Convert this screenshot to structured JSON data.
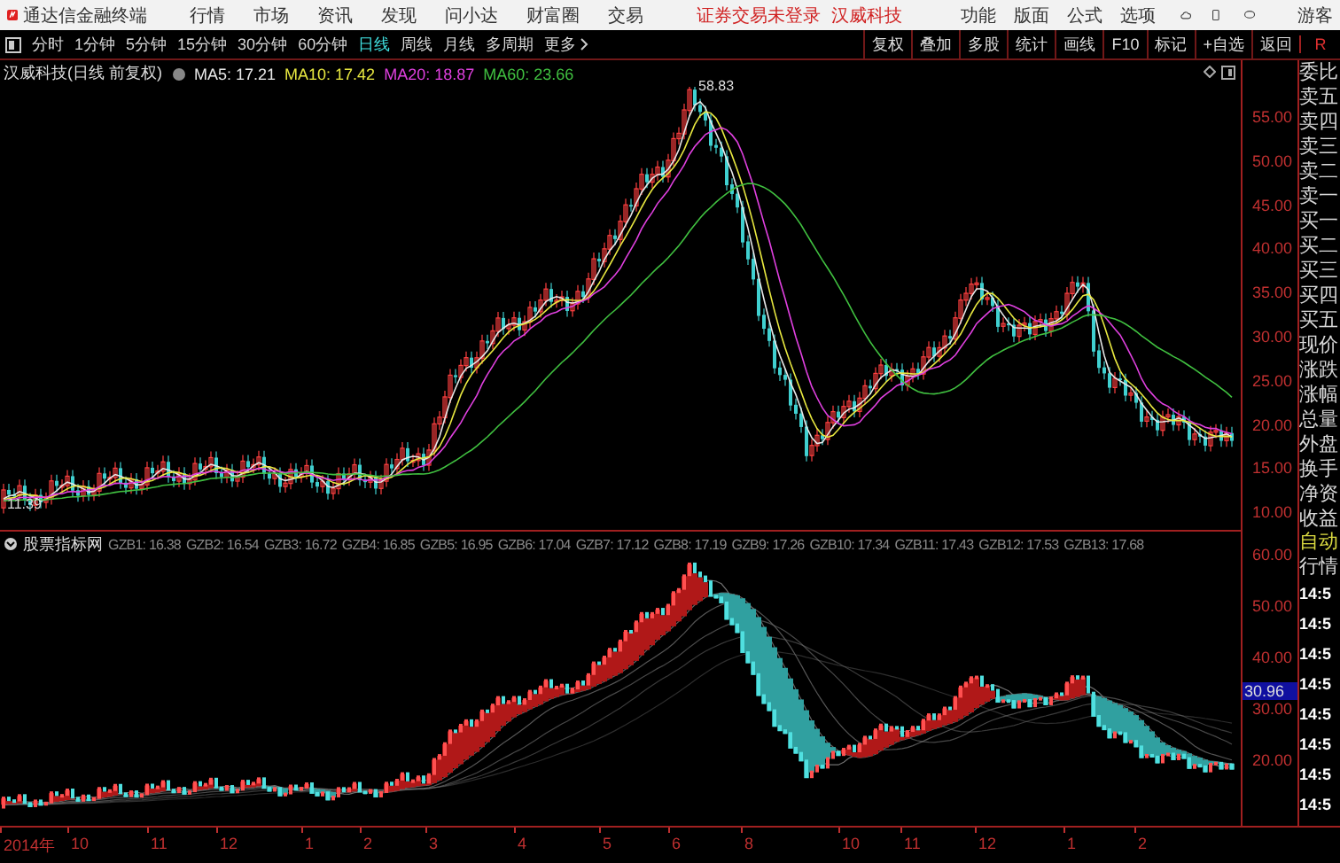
{
  "menu": {
    "app_title": "通达信金融终端",
    "items": [
      "行情",
      "市场",
      "资讯",
      "发现",
      "问小达",
      "财富圈",
      "交易"
    ],
    "notice": [
      "证券交易未登录",
      "汉威科技"
    ],
    "right_items": [
      "功能",
      "版面",
      "公式",
      "选项"
    ],
    "user": "游客"
  },
  "toolbar": {
    "periods": [
      {
        "label": "分时",
        "selected": false
      },
      {
        "label": "1分钟",
        "selected": false
      },
      {
        "label": "5分钟",
        "selected": false
      },
      {
        "label": "15分钟",
        "selected": false
      },
      {
        "label": "30分钟",
        "selected": false
      },
      {
        "label": "60分钟",
        "selected": false
      },
      {
        "label": "日线",
        "selected": true
      },
      {
        "label": "周线",
        "selected": false
      },
      {
        "label": "月线",
        "selected": false
      },
      {
        "label": "多周期",
        "selected": false
      },
      {
        "label": "更多",
        "selected": false
      }
    ],
    "buttons": [
      "复权",
      "叠加",
      "多股",
      "统计",
      "画线",
      "F10",
      "标记",
      "+自选",
      "返回"
    ],
    "corner": "R"
  },
  "chart": {
    "title": "汉威科技(日线 前复权)",
    "mas": [
      {
        "label": "MA5: 17.21",
        "color": "#e8e8e8"
      },
      {
        "label": "MA10: 17.42",
        "color": "#e8e840"
      },
      {
        "label": "MA20: 18.87",
        "color": "#e040e0"
      },
      {
        "label": "MA60: 23.66",
        "color": "#40c040"
      }
    ],
    "peak_label": "58.83",
    "low_label": "11.39",
    "price_axis": [
      "55.00",
      "50.00",
      "45.00",
      "40.00",
      "35.00",
      "30.00",
      "25.00",
      "20.00",
      "15.00",
      "10.00"
    ]
  },
  "indicator": {
    "name": "股票指标网",
    "readings": [
      "GZB1: 16.38",
      "GZB2: 16.54",
      "GZB3: 16.72",
      "GZB4: 16.85",
      "GZB5: 16.95",
      "GZB6: 17.04",
      "GZB7: 17.12",
      "GZB8: 17.19",
      "GZB9: 17.26",
      "GZB10: 17.34",
      "GZB11: 17.43",
      "GZB12: 17.53",
      "GZB13: 17.68"
    ],
    "axis": [
      "60.00",
      "50.00",
      "40.00",
      "30.00",
      "20.00"
    ],
    "current_value": "30.96"
  },
  "date_axis": [
    "2014年",
    "10",
    "11",
    "12",
    "1",
    "2",
    "3",
    "4",
    "5",
    "6",
    "8",
    "10",
    "11",
    "12",
    "1",
    "2"
  ],
  "side_panel": {
    "quote_labels": [
      "委比",
      "卖五",
      "卖四",
      "卖三",
      "卖二",
      "卖一",
      "买一",
      "买二",
      "买三",
      "买四",
      "买五",
      "现价",
      "涨跌",
      "涨幅",
      "总量",
      "外盘",
      "换手",
      "净资",
      "收益"
    ],
    "mode": "自动",
    "mode_label": "行情",
    "times": [
      "14:5",
      "14:5",
      "14:5",
      "14:5",
      "14:5",
      "14:5",
      "14:5",
      "14:5"
    ]
  }
}
